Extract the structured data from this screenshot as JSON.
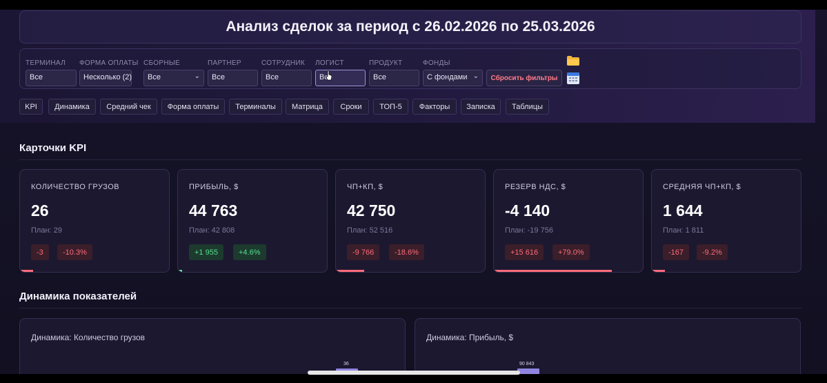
{
  "header": {
    "title": "Анализ сделок за период с 26.02.2026 по 25.03.2026"
  },
  "filters": [
    {
      "label": "ТЕРМИНАЛ",
      "value": "Все",
      "dropdown": false
    },
    {
      "label": "ФОРМА ОПЛАТЫ",
      "value": "Несколько (2)",
      "dropdown": false
    },
    {
      "label": "СБОРНЫЕ",
      "value": "Все",
      "dropdown": true
    },
    {
      "label": "ПАРТНЕР",
      "value": "Все",
      "dropdown": false
    },
    {
      "label": "СОТРУДНИК",
      "value": "Все",
      "dropdown": false
    },
    {
      "label": "ЛОГИСТ",
      "value": "Все",
      "dropdown": false
    },
    {
      "label": "ПРОДУКТ",
      "value": "Все",
      "dropdown": false
    },
    {
      "label": "ФОНДЫ",
      "value": "С фондами",
      "dropdown": true
    }
  ],
  "reset_label": "Сбросить фильтры",
  "icons": {
    "folder": "folder-icon",
    "calendar": "calendar-icon",
    "cursor": "mouse-cursor-icon"
  },
  "tabs": [
    "KPI",
    "Динамика",
    "Средний чек",
    "Форма оплаты",
    "Терминалы",
    "Матрица",
    "Сроки",
    "ТОП-5",
    "Факторы",
    "Записка",
    "Таблицы"
  ],
  "kpi_section_title": "Карточки KPI",
  "kpi_cards": [
    {
      "label": "КОЛИЧЕСТВО ГРУЗОВ",
      "value": "26",
      "plan": "План: 29",
      "delta": "-3",
      "delta_pct": "-10.3%",
      "status": "neg",
      "progress_pct": 9
    },
    {
      "label": "ПРИБЫЛЬ, $",
      "value": "44 763",
      "plan": "План: 42 808",
      "delta": "+1 955",
      "delta_pct": "+4.6%",
      "status": "pos",
      "progress_pct": 3
    },
    {
      "label": "ЧП+КП, $",
      "value": "42 750",
      "plan": "План: 52 516",
      "delta": "-9 766",
      "delta_pct": "-18.6%",
      "status": "neg",
      "progress_pct": 19
    },
    {
      "label": "РЕЗЕРВ НДС, $",
      "value": "-4 140",
      "plan": "План: -19 756",
      "delta": "+15 616",
      "delta_pct": "+79.0%",
      "status": "neg",
      "progress_pct": 79
    },
    {
      "label": "СРЕДНЯЯ ЧП+КП, $",
      "value": "1 644",
      "plan": "План: 1 811",
      "delta": "-167",
      "delta_pct": "-9.2%",
      "status": "neg",
      "progress_pct": 9
    }
  ],
  "dynamics_section_title": "Динамика показателей",
  "chart_data": [
    {
      "type": "bar",
      "title": "Динамика: Количество грузов",
      "data_labels": [
        "36"
      ],
      "values": [
        36
      ]
    },
    {
      "type": "bar",
      "title": "Динамика: Прибыль, $",
      "data_labels": [
        "90 843"
      ],
      "values": [
        90843
      ]
    }
  ],
  "colors": {
    "negative": "#ff6b7a",
    "positive": "#56e08f",
    "accent": "#8f85e0",
    "reset_text": "#ff7b89"
  }
}
